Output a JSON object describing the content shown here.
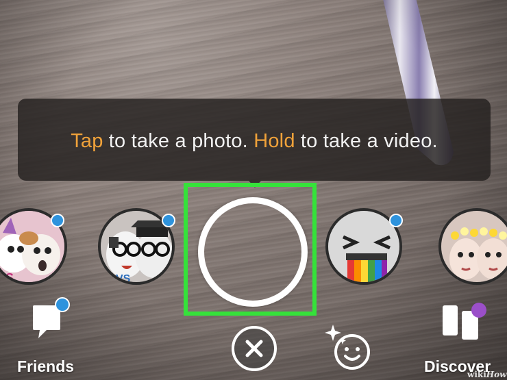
{
  "tooltip": {
    "tap_word": "Tap",
    "tap_rest": " to take a photo. ",
    "hold_word": "Hold",
    "hold_rest": " to take a video.",
    "accent_color": "#f0a23a"
  },
  "highlight_color": "#35e23a",
  "lenses": [
    {
      "name": "cat-dog-vs-lens",
      "icon": "lens-cat-vs-dog",
      "has_new_dot": true
    },
    {
      "name": "glasses-vs-lens",
      "icon": "lens-glasses-vs",
      "has_new_dot": true
    },
    {
      "name": "rainbow-lens",
      "icon": "lens-rainbow-puke",
      "has_new_dot": true
    },
    {
      "name": "flower-crown-lens",
      "icon": "lens-flower-crown",
      "has_new_dot": false
    }
  ],
  "nav": {
    "friends_label": "Friends",
    "discover_label": "Discover"
  },
  "dot_colors": {
    "blue": "#2e93dd",
    "purple": "#9b4fc9"
  },
  "watermark": {
    "wiki": "wiki",
    "how": "How"
  }
}
